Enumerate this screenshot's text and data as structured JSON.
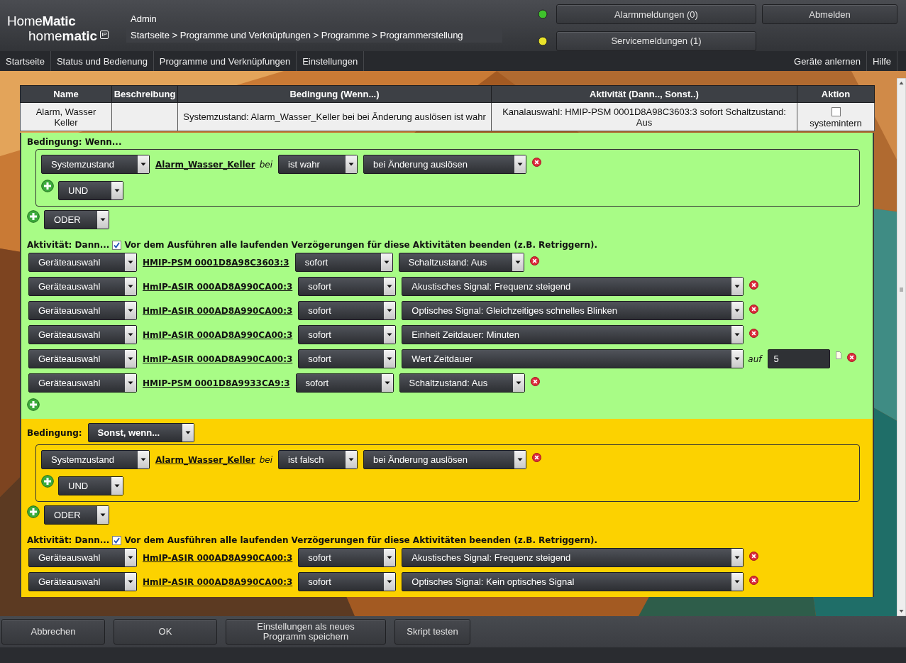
{
  "header": {
    "logo_top": "Home**Matic**",
    "logo_bottom": "home**matic**",
    "logo_badge": "IP",
    "user": "Admin",
    "breadcrumb": "Startseite > Programme und Verknüpfungen > Programme > Programmerstellung",
    "status": [
      {
        "label": "Alarmmeldungen (0)",
        "color": "#3fc22c"
      },
      {
        "label": "Servicemeldungen (1)",
        "color": "#e9e22a"
      }
    ],
    "logout": "Abmelden"
  },
  "nav": {
    "left": [
      "Startseite",
      "Status und Bedienung",
      "Programme und Verknüpfungen",
      "Einstellungen"
    ],
    "right": [
      "Geräte anlernen",
      "Hilfe"
    ]
  },
  "table": {
    "columns": [
      "Name",
      "Beschreibung",
      "Bedingung (Wenn...)",
      "Aktivität (Dann.., Sonst..)",
      "Aktion"
    ],
    "rows": [
      {
        "name": "Alarm, Wasser Keller",
        "condition": "Systemzustand: Alarm_Wasser_Keller bei bei Änderung auslösen ist wahr",
        "activity": "Kanalauswahl: HMIP-PSM 0001D8A98C3603:3 sofort Schaltzustand: Aus",
        "action_checked": false,
        "action_label": "systemintern"
      }
    ]
  },
  "sections": [
    {
      "color": "#a8fc86",
      "heading": "Bedingung: Wenn...",
      "conditions": [
        {
          "type": "Systemzustand",
          "target": "Alarm_Wasser_Keller",
          "joiner": "bei",
          "state": "ist wahr",
          "trigger": "bei Änderung auslösen"
        }
      ],
      "and_label": "UND",
      "or_label": "ODER",
      "activity_label": "Aktivität: Dann...",
      "retrigger_checked": true,
      "retrigger_text": "Vor dem Ausführen alle laufenden Verzögerungen für diese Aktivitäten beenden (z.B. Retriggern).",
      "actions": [
        {
          "kind": "switch",
          "mode": "Geräteauswahl",
          "device": "HMIP-PSM 0001D8A98C3603:3",
          "timing": "sofort",
          "param": "Schaltzustand: Aus"
        },
        {
          "kind": "siren",
          "mode": "Geräteauswahl",
          "device": "HmIP-ASIR 000AD8A990CA00:3",
          "timing": "sofort",
          "param": "Akustisches Signal: Frequenz steigend"
        },
        {
          "kind": "siren",
          "mode": "Geräteauswahl",
          "device": "HmIP-ASIR 000AD8A990CA00:3",
          "timing": "sofort",
          "param": "Optisches Signal: Gleichzeitiges schnelles Blinken"
        },
        {
          "kind": "siren",
          "mode": "Geräteauswahl",
          "device": "HmIP-ASIR 000AD8A990CA00:3",
          "timing": "sofort",
          "param": "Einheit Zeitdauer: Minuten"
        },
        {
          "kind": "siren",
          "mode": "Geräteauswahl",
          "device": "HmIP-ASIR 000AD8A990CA00:3",
          "timing": "sofort",
          "param": "Wert Zeitdauer",
          "value_prefix": "auf",
          "value": "5"
        },
        {
          "kind": "switch",
          "mode": "Geräteauswahl",
          "device": "HMIP-PSM 0001D8A9933CA9:3",
          "timing": "sofort",
          "param": "Schaltzustand: Aus"
        }
      ]
    },
    {
      "color": "#fcd200",
      "heading": "Bedingung:",
      "heading_select": "Sonst, wenn...",
      "conditions": [
        {
          "type": "Systemzustand",
          "target": "Alarm_Wasser_Keller",
          "joiner": "bei",
          "state": "ist falsch",
          "trigger": "bei Änderung auslösen"
        }
      ],
      "and_label": "UND",
      "or_label": "ODER",
      "activity_label": "Aktivität: Dann...",
      "retrigger_checked": true,
      "retrigger_text": "Vor dem Ausführen alle laufenden Verzögerungen für diese Aktivitäten beenden (z.B. Retriggern).",
      "actions": [
        {
          "kind": "siren",
          "mode": "Geräteauswahl",
          "device": "HmIP-ASIR 000AD8A990CA00:3",
          "timing": "sofort",
          "param": "Akustisches Signal: Frequenz steigend"
        },
        {
          "kind": "siren",
          "mode": "Geräteauswahl",
          "device": "HmIP-ASIR 000AD8A990CA00:3",
          "timing": "sofort",
          "param": "Optisches Signal: Kein optisches Signal"
        }
      ]
    }
  ],
  "footer": {
    "buttons": [
      "Abbrechen",
      "OK",
      "Einstellungen als neues Programm speichern",
      "Skript testen"
    ]
  }
}
